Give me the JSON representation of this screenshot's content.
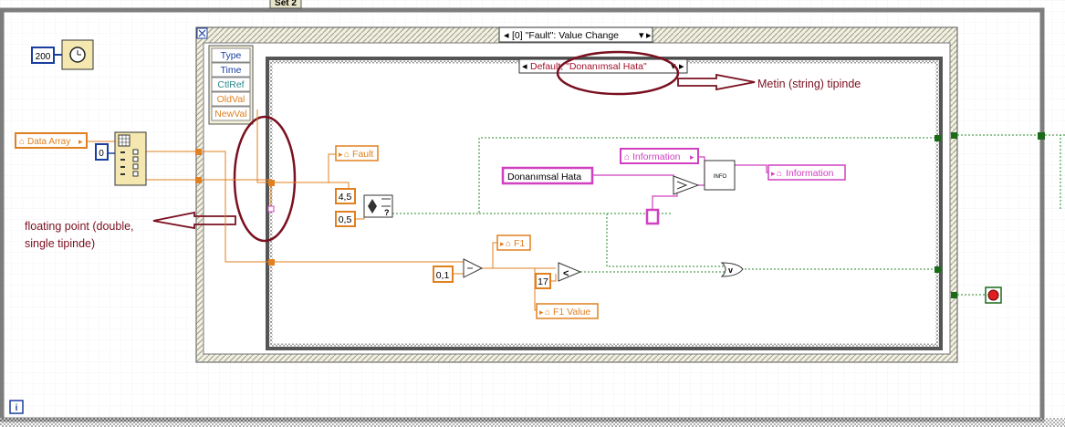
{
  "title_tab": "Set 2",
  "wait_constant": "200",
  "outer_case_selector": "[0] \"Fault\": Value Change",
  "event_data_fields": [
    "Type",
    "Time",
    "CtlRef",
    "OldVal",
    "NewVal"
  ],
  "inner_case_selector": "Default, \"Donanımsal Hata\"",
  "annotations": {
    "string_note": "Metin (string) tipinde",
    "float_note_line1": "floating point (double,",
    "float_note_line2": "single tipinde)"
  },
  "controls": {
    "data_array": "Data Array",
    "index_constant": "0",
    "fault": "Fault",
    "upper_limit": "4,5",
    "lower_limit": "0,5",
    "f1": "F1",
    "f1_offset": "0,1",
    "threshold": "17",
    "f1_value": "F1 Value",
    "message_string": "Donanımsal Hata",
    "information_in": "Information",
    "information_out": "Information",
    "info_node": "INFO"
  },
  "info_button": "i",
  "colors": {
    "orange_wire": "#e08020",
    "pink_wire": "#d040c0",
    "green_wire": "#2a8a2a",
    "blue_wire": "#1a3ea0",
    "annotation": "#7a1020",
    "structure_frame": "#808080"
  }
}
